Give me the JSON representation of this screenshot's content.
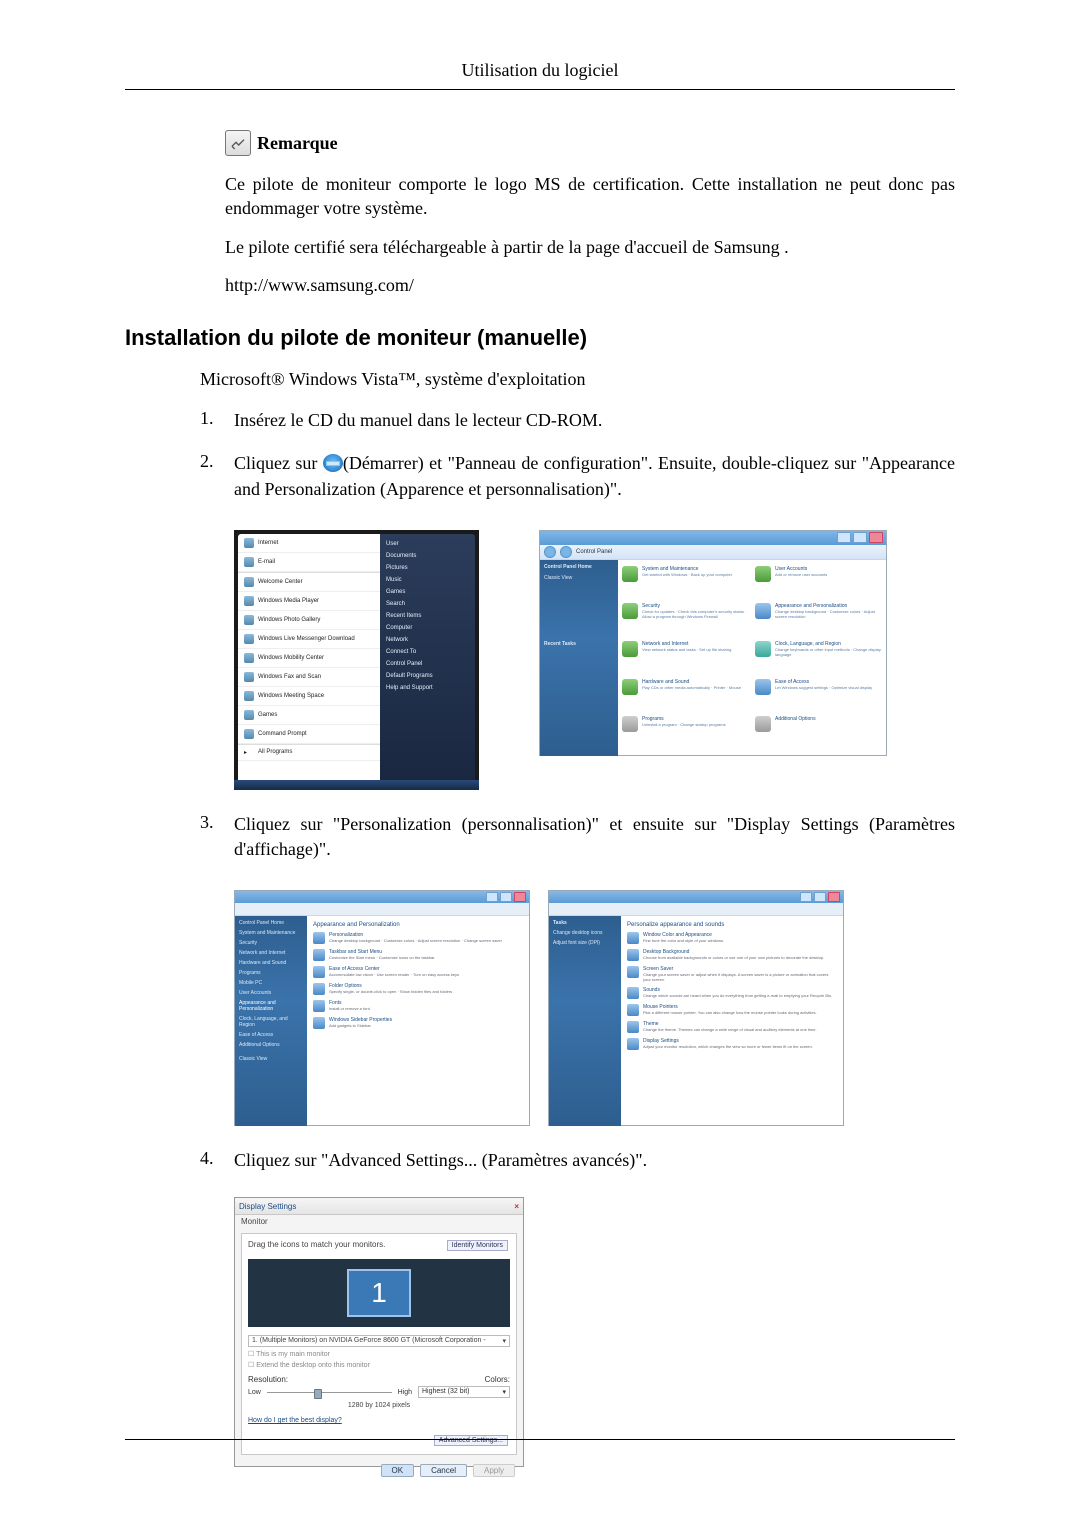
{
  "header": {
    "title": "Utilisation du logiciel"
  },
  "remarque": {
    "label": "Remarque",
    "p1": "Ce pilote de moniteur comporte le logo MS de certification. Cette installation ne peut donc pas endommager votre système.",
    "p2": "Le pilote certifié sera téléchargeable à partir de la page d'accueil de Samsung .",
    "url": "http://www.samsung.com/"
  },
  "h2": "Installation du pilote de moniteur (manuelle)",
  "intro": "Microsoft® Windows Vista™, système d'exploitation",
  "steps": {
    "s1_num": "1.",
    "s1": "Insérez le CD du manuel dans le lecteur CD-ROM.",
    "s2_num": "2.",
    "s2a": "Cliquez sur ",
    "s2b": "(Démarrer) et \"Panneau de configuration\". Ensuite, double-cliquez sur \"Appearance and Personalization (Apparence et personnalisation)\".",
    "s3_num": "3.",
    "s3": "Cliquez sur \"Personalization (personnalisation)\" et ensuite sur \"Display Settings (Paramètres d'affichage)\".",
    "s4_num": "4.",
    "s4": "Cliquez sur \"Advanced Settings... (Paramètres avancés)\"."
  },
  "startmenu": {
    "items": [
      "Internet",
      "E-mail",
      "Welcome Center",
      "Windows Media Player",
      "Windows Photo Gallery",
      "Windows Live Messenger Download",
      "Windows Mobility Center",
      "Windows Fax and Scan",
      "Windows Meeting Space",
      "Games",
      "Command Prompt"
    ],
    "allprograms": "All Programs",
    "right": [
      "User",
      "Documents",
      "Pictures",
      "Music",
      "Games",
      "Search",
      "Recent Items",
      "Computer",
      "Network",
      "Connect To",
      "Control Panel",
      "Default Programs",
      "Help and Support"
    ]
  },
  "controlpanel": {
    "addr": "Control Panel",
    "side_title": "Control Panel Home",
    "side_link": "Classic View",
    "side_recent": "Recent Tasks",
    "cats": [
      {
        "t": "System and Maintenance",
        "s": "Get started with Windows · Back up your computer"
      },
      {
        "t": "User Accounts",
        "s": "Add or remove user accounts"
      },
      {
        "t": "Security",
        "s": "Check for updates · Check this computer's security status · Allow a program through Windows Firewall"
      },
      {
        "t": "Appearance and Personalization",
        "s": "Change desktop background · Customize colors · Adjust screen resolution"
      },
      {
        "t": "Network and Internet",
        "s": "View network status and tasks · Set up file sharing"
      },
      {
        "t": "Clock, Language, and Region",
        "s": "Change keyboards or other input methods · Change display language"
      },
      {
        "t": "Hardware and Sound",
        "s": "Play CDs or other media automatically · Printer · Mouse"
      },
      {
        "t": "Ease of Access",
        "s": "Let Windows suggest settings · Optimize visual display"
      },
      {
        "t": "Programs",
        "s": "Uninstall a program · Change startup programs"
      },
      {
        "t": "Additional Options",
        "s": ""
      }
    ]
  },
  "personalization_win": {
    "side": [
      "Control Panel Home",
      "System and Maintenance",
      "Security",
      "Network and Internet",
      "Hardware and Sound",
      "Programs",
      "Mobile PC",
      "User Accounts",
      "Appearance and Personalization",
      "Clock, Language, and Region",
      "Ease of Access",
      "Additional Options",
      "Classic View"
    ],
    "hdr": "Appearance and Personalization",
    "items": [
      {
        "t": "Personalization",
        "s": "Change desktop background · Customize colors · Adjust screen resolution · Change screen saver"
      },
      {
        "t": "Taskbar and Start Menu",
        "s": "Customize the Start menu · Customize icons on the taskbar"
      },
      {
        "t": "Ease of Access Center",
        "s": "Accommodate low vision · Use screen reader · Turn on easy access keys"
      },
      {
        "t": "Folder Options",
        "s": "Specify single- or double-click to open · Show hidden files and folders"
      },
      {
        "t": "Fonts",
        "s": "Install or remove a font"
      },
      {
        "t": "Windows Sidebar Properties",
        "s": "Add gadgets to Sidebar"
      }
    ]
  },
  "personalize_win": {
    "side": [
      "Tasks",
      "Change desktop icons",
      "Adjust font size (DPI)"
    ],
    "hdr": "Personalize appearance and sounds",
    "items": [
      {
        "t": "Window Color and Appearance",
        "s": "Fine tune the color and style of your windows."
      },
      {
        "t": "Desktop Background",
        "s": "Choose from available backgrounds or colors or use one of your own pictures to decorate the desktop."
      },
      {
        "t": "Screen Saver",
        "s": "Change your screen saver or adjust when it displays. A screen saver is a picture or animation that covers your screen."
      },
      {
        "t": "Sounds",
        "s": "Change which sounds are heard when you do everything from getting e-mail to emptying your Recycle Bin."
      },
      {
        "t": "Mouse Pointers",
        "s": "Pick a different mouse pointer. You can also change how the mouse pointer looks during activities."
      },
      {
        "t": "Theme",
        "s": "Change the theme. Themes can change a wide range of visual and auditory elements at one time."
      },
      {
        "t": "Display Settings",
        "s": "Adjust your monitor resolution, which changes the view so more or fewer items fit on the screen."
      }
    ]
  },
  "display_settings": {
    "title": "Display Settings",
    "tab": "Monitor",
    "drag": "Drag the icons to match your monitors.",
    "identify": "Identify Monitors",
    "monitor_num": "1",
    "selector": "1. (Multiple Monitors) on NVIDIA GeForce 8600 GT (Microsoft Corporation -",
    "chk1": "This is my main monitor",
    "chk2": "Extend the desktop onto this monitor",
    "res_label": "Resolution:",
    "col_label": "Colors:",
    "low": "Low",
    "high": "High",
    "colors_value": "Highest (32 bit)",
    "res_text": "1280 by 1024 pixels",
    "help": "How do I get the best display?",
    "adv": "Advanced Settings...",
    "ok": "OK",
    "cancel": "Cancel",
    "apply": "Apply"
  }
}
